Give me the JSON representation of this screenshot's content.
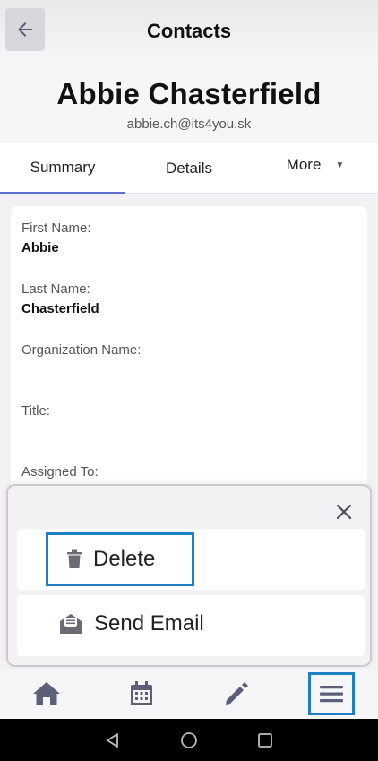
{
  "header": {
    "title": "Contacts",
    "back_icon": "arrow-left-icon"
  },
  "profile": {
    "name": "Abbie Chasterfield",
    "email": "abbie.ch@its4you.sk"
  },
  "tabs": [
    {
      "label": "Summary",
      "active": true
    },
    {
      "label": "Details",
      "active": false
    },
    {
      "label": "More",
      "active": false
    }
  ],
  "fields": [
    {
      "label": "First Name:",
      "value": "Abbie"
    },
    {
      "label": "Last Name:",
      "value": "Chasterfield"
    },
    {
      "label": "Organization Name:",
      "value": ""
    },
    {
      "label": "Title:",
      "value": ""
    },
    {
      "label": "Assigned To:",
      "value": ""
    }
  ],
  "sheet": {
    "actions": [
      {
        "label": "Delete",
        "icon": "trash-icon"
      },
      {
        "label": "Send Email",
        "icon": "envelope-open-icon"
      }
    ],
    "close_icon": "close-icon"
  },
  "bottom_nav": [
    {
      "icon": "home-icon"
    },
    {
      "icon": "calendar-icon"
    },
    {
      "icon": "pencil-icon"
    },
    {
      "icon": "menu-icon"
    }
  ],
  "colors": {
    "accent": "#5b6fd6",
    "highlight_border": "#1f7fc4",
    "icon_gray": "#6b6b74",
    "nav_icon": "#5d5e78"
  }
}
